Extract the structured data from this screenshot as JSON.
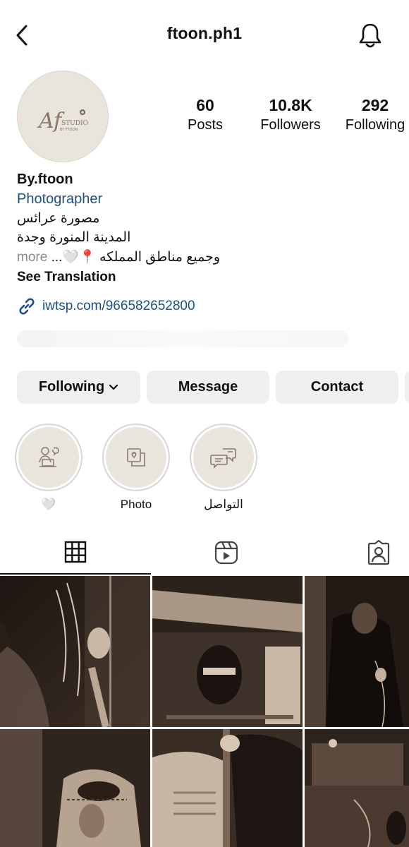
{
  "header": {
    "username": "ftoon.ph1",
    "back_icon": "chevron-left-icon",
    "notification_icon": "bell-icon"
  },
  "profile": {
    "avatar_logo_text": "Af",
    "avatar_logo_sub": "STUDIO",
    "avatar_logo_sub2": "BY FTOON",
    "stats": [
      {
        "value": "60",
        "label": "Posts"
      },
      {
        "value": "10.8K",
        "label": "Followers"
      },
      {
        "value": "292",
        "label": "Following"
      }
    ],
    "display_name": "By.ftoon",
    "category": "Photographer",
    "bio_lines": [
      "مصورة عرائس",
      "المدينة المنورة وجدة",
      "وجميع مناطق المملكه 📍🤍..."
    ],
    "more_label": "more",
    "see_translation": "See Translation",
    "link": "iwtsp.com/966582652800"
  },
  "actions": {
    "following_label": "Following",
    "message_label": "Message",
    "contact_label": "Contact"
  },
  "highlights": [
    {
      "label": "🤍",
      "icon": "person-laptop-icon"
    },
    {
      "label": "Photo",
      "icon": "photo-frame-icon"
    },
    {
      "label": "التواصل",
      "icon": "chat-bubbles-icon"
    }
  ],
  "tabs": [
    {
      "name": "posts-grid",
      "icon": "grid-icon"
    },
    {
      "name": "reels",
      "icon": "reels-icon"
    },
    {
      "name": "tagged",
      "icon": "tagged-person-icon"
    }
  ],
  "colors": {
    "link_blue": "#1f4f84",
    "button_gray": "#efefef",
    "avatar_beige": "#e9e4dc",
    "photo_sepia_dark": "#2a1f19",
    "photo_sepia_light": "#d8c9b8"
  }
}
